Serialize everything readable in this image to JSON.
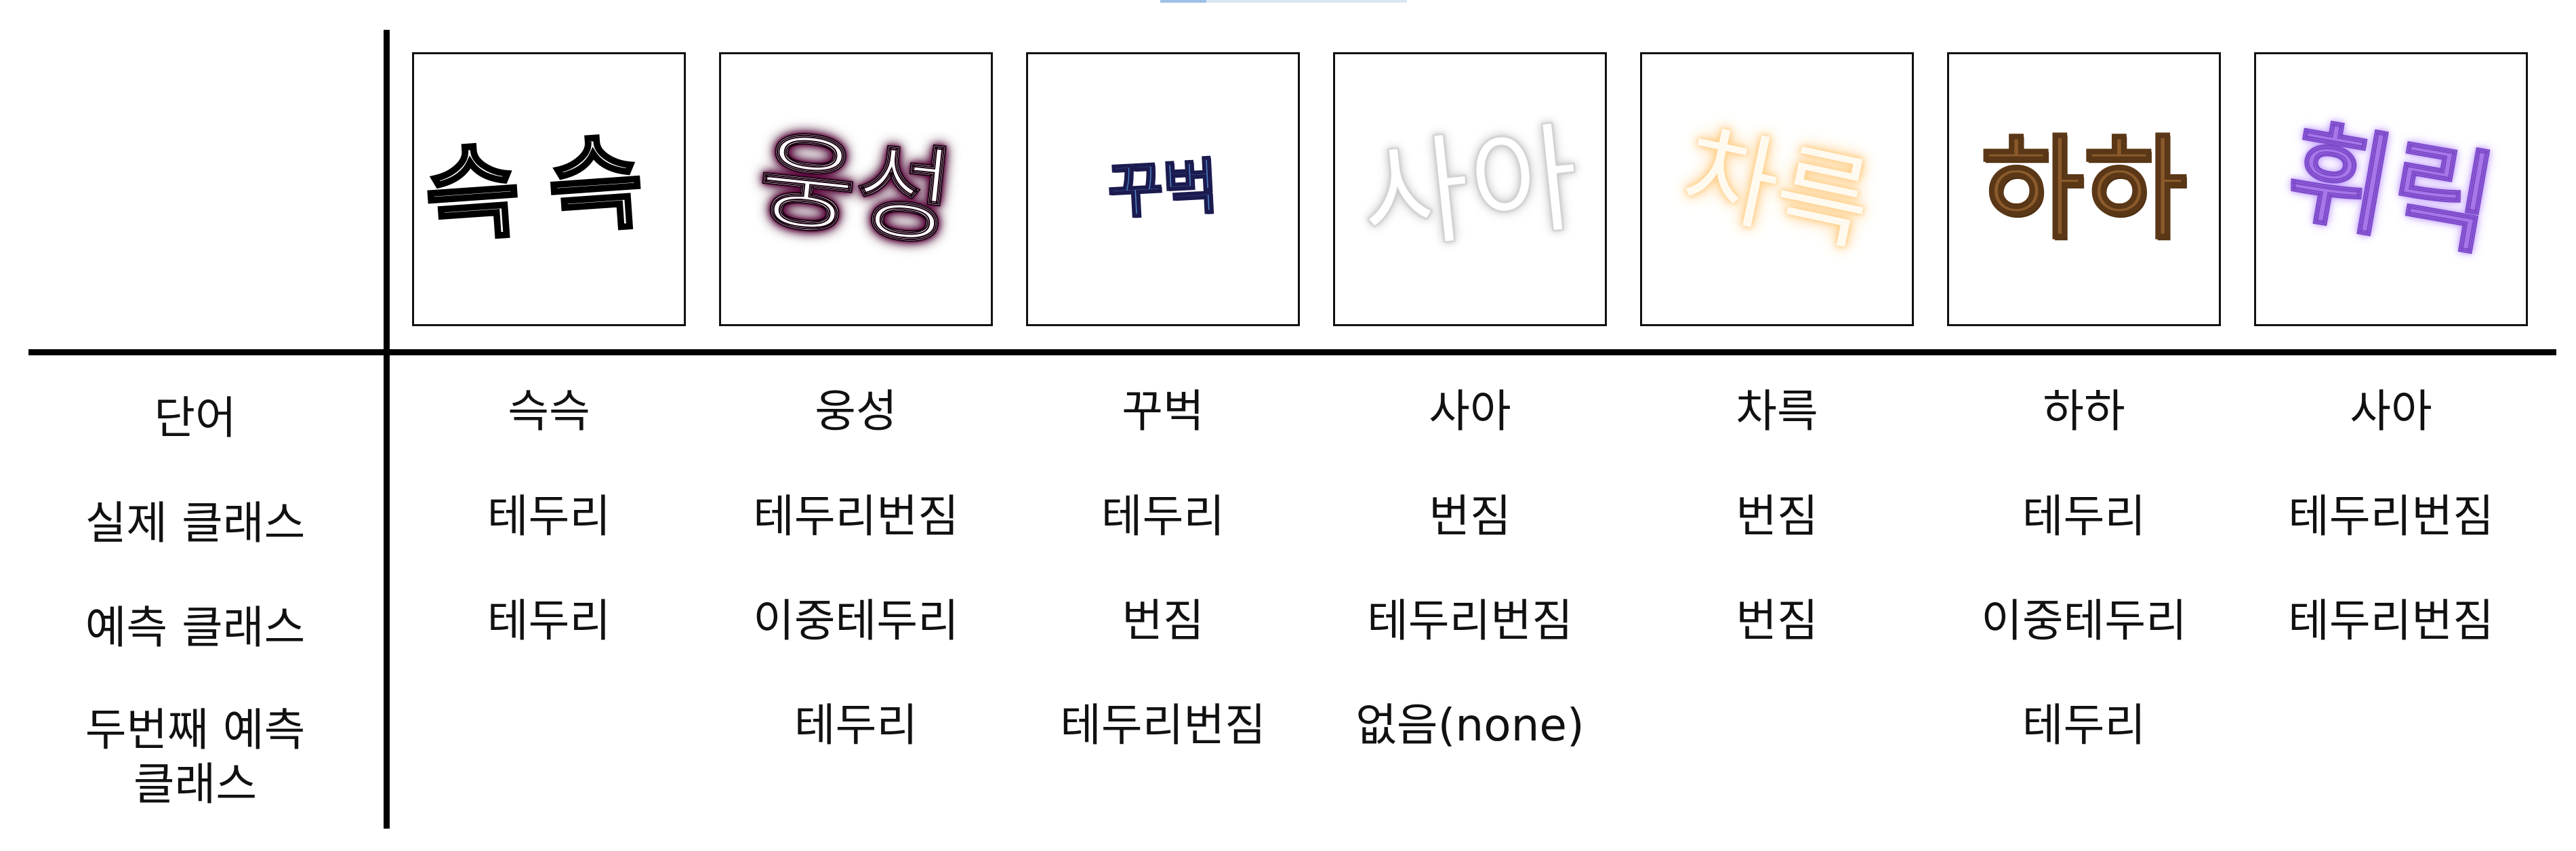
{
  "row_labels": {
    "word": "단어",
    "actual_class": "실제 클래스",
    "predicted_class": "예측 클래스",
    "second_predicted_class_line1": "두번째 예측",
    "second_predicted_class_line2": "클래스"
  },
  "samples": [
    {
      "image_text": "슥슥",
      "word": "슥슥",
      "actual_class": "테두리",
      "predicted_class": "테두리",
      "second_predicted_class": ""
    },
    {
      "image_text": "웅성",
      "word": "웅성",
      "actual_class": "테두리번짐",
      "predicted_class": "이중테두리",
      "second_predicted_class": "테두리"
    },
    {
      "image_text": "꾸벅",
      "word": "꾸벅",
      "actual_class": "테두리",
      "predicted_class": "번짐",
      "second_predicted_class": "테두리번짐"
    },
    {
      "image_text": "사아",
      "word": "사아",
      "actual_class": "번짐",
      "predicted_class": "테두리번짐",
      "second_predicted_class": "없음(none)"
    },
    {
      "image_text": "차륵",
      "word": "차륵",
      "actual_class": "번짐",
      "predicted_class": "번짐",
      "second_predicted_class": ""
    },
    {
      "image_text": "하하",
      "word": "하하",
      "actual_class": "테두리",
      "predicted_class": "이중테두리",
      "second_predicted_class": "테두리"
    },
    {
      "image_text": "휘릭",
      "word": "사아",
      "actual_class": "테두리번짐",
      "predicted_class": "테두리번짐",
      "second_predicted_class": ""
    }
  ]
}
